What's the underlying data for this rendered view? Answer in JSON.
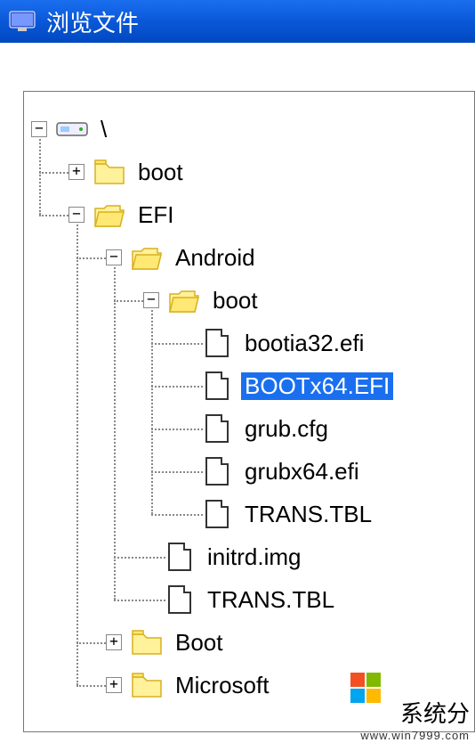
{
  "window": {
    "title": "浏览文件"
  },
  "tree": {
    "root_label": "\\",
    "nodes": {
      "boot_top": "boot",
      "efi": "EFI",
      "android": "Android",
      "boot_sub": "boot",
      "bootia32": "bootia32.efi",
      "bootx64": "BOOTx64.EFI",
      "grubcfg": "grub.cfg",
      "grubx64": "grubx64.efi",
      "trans1": "TRANS.TBL",
      "initrd": "initrd.img",
      "trans2": "TRANS.TBL",
      "boot_efi": "Boot",
      "microsoft": "Microsoft"
    },
    "expand": {
      "plus": "+",
      "minus": "−"
    },
    "selected": "bootx64"
  },
  "watermark": {
    "line1": "系统分",
    "line2": "www.win7999.com"
  },
  "colors": {
    "titlebar": "#0a58d8",
    "folder": "#fff29a",
    "folder_edge": "#d8b020",
    "selection": "#1a6fef"
  }
}
